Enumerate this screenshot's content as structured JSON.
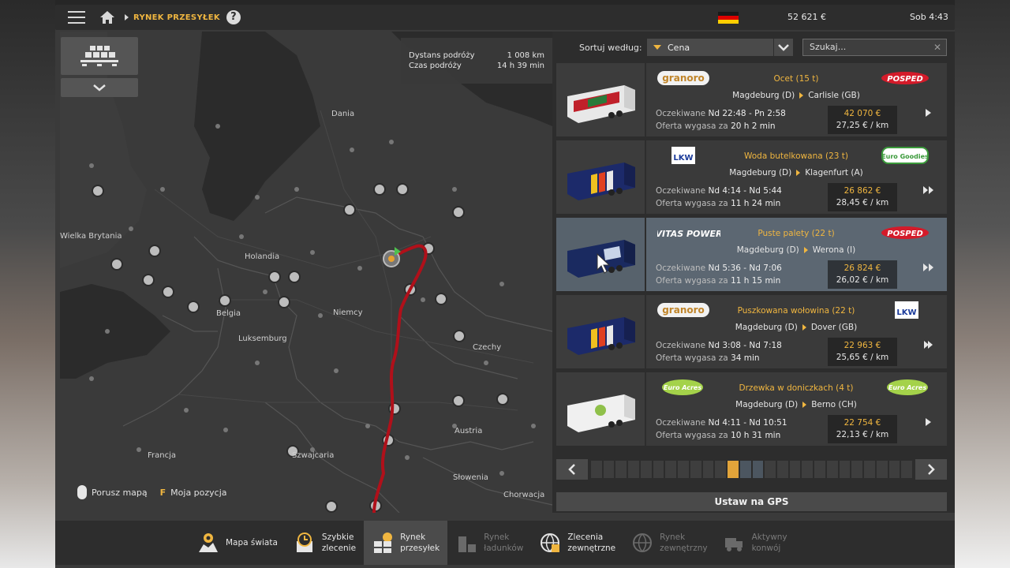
{
  "topbar": {
    "breadcrumb": "RYNEK PRZESYŁEK",
    "help": "?",
    "money": "52 621 €",
    "time": "Sob 4:43"
  },
  "map": {
    "trip": {
      "distance_label": "Dystans podróży",
      "distance_value": "1 008 km",
      "time_label": "Czas podróży",
      "time_value": "14 h 39 min"
    },
    "labels": {
      "dania": "Dania",
      "wielka_brytania": "Wielka Brytania",
      "holandia": "Holandia",
      "belgia": "Belgia",
      "luksemburg": "Luksemburg",
      "niemcy": "Niemcy",
      "czechy": "Czechy",
      "austria": "Austria",
      "szwajcaria": "Szwajcaria",
      "francja": "Francja",
      "slowenia": "Słowenia",
      "chorwacja": "Chorwacja"
    },
    "footer": {
      "move_map": "Porusz mapą",
      "f_key": "F",
      "my_position": "Moja pozycja"
    }
  },
  "sort": {
    "label": "Sortuj według:",
    "selected": "Cena",
    "search_placeholder": "Szukaj..."
  },
  "offers": [
    {
      "company": "granoro",
      "client": "POSPED",
      "cargo": "Ocet (15 t)",
      "from": "Magdeburg (D)",
      "to": "Carlisle (GB)",
      "expected_label": "Oczekiwane",
      "expected": "Nd 22:48 - Pn 2:58",
      "expires_label": "Oferta wygasa za",
      "expires": "20 h 2 min",
      "price": "42 070 €",
      "rate": "27,25 € / km"
    },
    {
      "company": "LKW",
      "client": "Euro Goodies",
      "cargo": "Woda butelkowana (23 t)",
      "from": "Magdeburg (D)",
      "to": "Klagenfurt (A)",
      "expected_label": "Oczekiwane",
      "expected": "Nd 4:14 - Nd 5:44",
      "expires_label": "Oferta wygasa za",
      "expires": "11 h 24 min",
      "price": "26 862 €",
      "rate": "28,45 € / km"
    },
    {
      "company": "VITAS POWER",
      "client": "POSPED",
      "cargo": "Puste palety (22 t)",
      "from": "Magdeburg (D)",
      "to": "Werona (I)",
      "expected_label": "Oczekiwane",
      "expected": "Nd 5:36 - Nd 7:06",
      "expires_label": "Oferta wygasa za",
      "expires": "11 h 15 min",
      "price": "26 824 €",
      "rate": "26,02 € / km"
    },
    {
      "company": "granoro",
      "client": "LKW",
      "cargo": "Puszkowana wołowina (22 t)",
      "from": "Magdeburg (D)",
      "to": "Dover (GB)",
      "expected_label": "Oczekiwane",
      "expected": "Nd 3:08 - Nd 7:18",
      "expires_label": "Oferta wygasa za",
      "expires": "34 min",
      "price": "22 963 €",
      "rate": "25,65 € / km"
    },
    {
      "company": "Euro Acres",
      "client": "Euro Acres",
      "cargo": "Drzewka w doniczkach (4 t)",
      "from": "Magdeburg (D)",
      "to": "Berno (CH)",
      "expected_label": "Oczekiwane",
      "expected": "Nd 4:11 - Nd 10:51",
      "expires_label": "Oferta wygasa za",
      "expires": "10 h 31 min",
      "price": "22 754 €",
      "rate": "22,13 € / km"
    }
  ],
  "gps_button": "Ustaw na GPS",
  "bottom": {
    "world_map": "Mapa świata",
    "quick_job_1": "Szybkie",
    "quick_job_2": "zlecenie",
    "freight_1": "Rynek",
    "freight_2": "przesyłek",
    "cargo_1": "Rynek",
    "cargo_2": "ładunków",
    "external_1": "Zlecenia",
    "external_2": "zewnętrzne",
    "ext_market_1": "Rynek",
    "ext_market_2": "zewnętrzny",
    "active_1": "Aktywny",
    "active_2": "konwój"
  },
  "colors": {
    "accent": "#f0b640",
    "route": "#b0101a",
    "selected_row": "#5c6772"
  }
}
